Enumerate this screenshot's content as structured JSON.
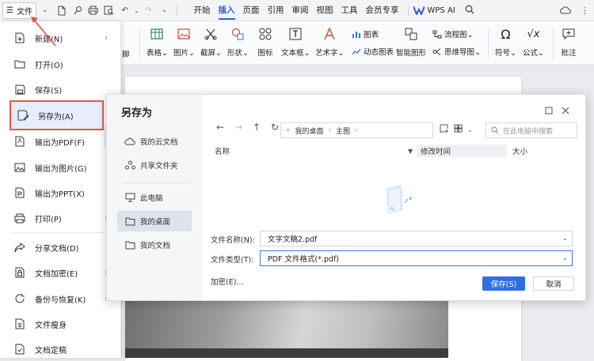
{
  "topbar": {
    "file_label": "文件",
    "tabs": [
      "开始",
      "插入",
      "页面",
      "引用",
      "审阅",
      "视图",
      "工具",
      "会员专享"
    ],
    "active_tab": "插入",
    "wps_ai": "WPS AI"
  },
  "ribbon": {
    "partial_left": "脚",
    "items": [
      {
        "label": "表格",
        "has_dropdown": true
      },
      {
        "label": "图片",
        "has_dropdown": true
      },
      {
        "label": "截屏",
        "has_dropdown": true
      },
      {
        "label": "形状",
        "has_dropdown": true
      },
      {
        "label": "图标",
        "has_dropdown": false
      },
      {
        "label": "文本框",
        "has_dropdown": true
      },
      {
        "label": "艺术字",
        "has_dropdown": true
      }
    ],
    "chart_label": "图表",
    "dynamic_chart_label": "动态图表",
    "smart_graphic_label": "智能图形",
    "flowchart_label": "流程图",
    "mindmap_label": "思维导图",
    "symbol_label": "符号",
    "formula_label": "公式",
    "comment_label": "批注"
  },
  "file_menu": {
    "items": [
      {
        "label": "新建(N)",
        "icon": "new-doc-icon",
        "submenu": true
      },
      {
        "label": "打开(O)",
        "icon": "folder-open-icon",
        "submenu": false
      },
      {
        "label": "保存(S)",
        "icon": "save-icon",
        "submenu": false
      },
      {
        "label": "另存为(A)",
        "icon": "save-as-icon",
        "submenu": true,
        "selected": true
      },
      {
        "label": "输出为PDF(F)",
        "icon": "pdf-icon",
        "submenu": false
      },
      {
        "label": "输出为图片(G)",
        "icon": "image-export-icon",
        "submenu": false
      },
      {
        "label": "输出为PPT(X)",
        "icon": "ppt-export-icon",
        "submenu": false
      },
      {
        "label": "打印(P)",
        "icon": "print-icon",
        "submenu": true
      },
      {
        "label": "分享文档(D)",
        "icon": "share-icon",
        "submenu": false
      },
      {
        "label": "文档加密(E)",
        "icon": "encrypt-icon",
        "submenu": true
      },
      {
        "label": "备份与恢复(K)",
        "icon": "backup-icon",
        "submenu": true
      },
      {
        "label": "文件瘦身",
        "icon": "slim-icon",
        "submenu": false
      },
      {
        "label": "文档定稿",
        "icon": "finalize-icon",
        "submenu": false
      }
    ]
  },
  "dialog": {
    "title": "另存为",
    "sidebar": [
      {
        "label": "我的云文档",
        "icon": "cloud-icon"
      },
      {
        "label": "共享文件夹",
        "icon": "shared-folder-icon"
      },
      {
        "label": "此电脑",
        "icon": "monitor-icon"
      },
      {
        "label": "我的桌面",
        "icon": "folder-icon",
        "active": true
      },
      {
        "label": "我的文档",
        "icon": "folder-icon"
      }
    ],
    "path": [
      "我的桌面",
      "主图"
    ],
    "search_placeholder": "在此电脑中搜索",
    "columns": {
      "name": "名称",
      "modified": "修改时间",
      "size": "大小"
    },
    "filename_label": "文件名称(N):",
    "filename_value": "文字文稿2.pdf",
    "filetype_label": "文件类型(T):",
    "filetype_value": "PDF 文件格式(*.pdf)",
    "encrypt_link": "加密(E)...",
    "save_button": "保存(S)",
    "cancel_button": "取消"
  },
  "colors": {
    "accent": "#2f6fde",
    "highlight_border": "#e05a4a",
    "annotation_arrow": "#e0503f"
  }
}
